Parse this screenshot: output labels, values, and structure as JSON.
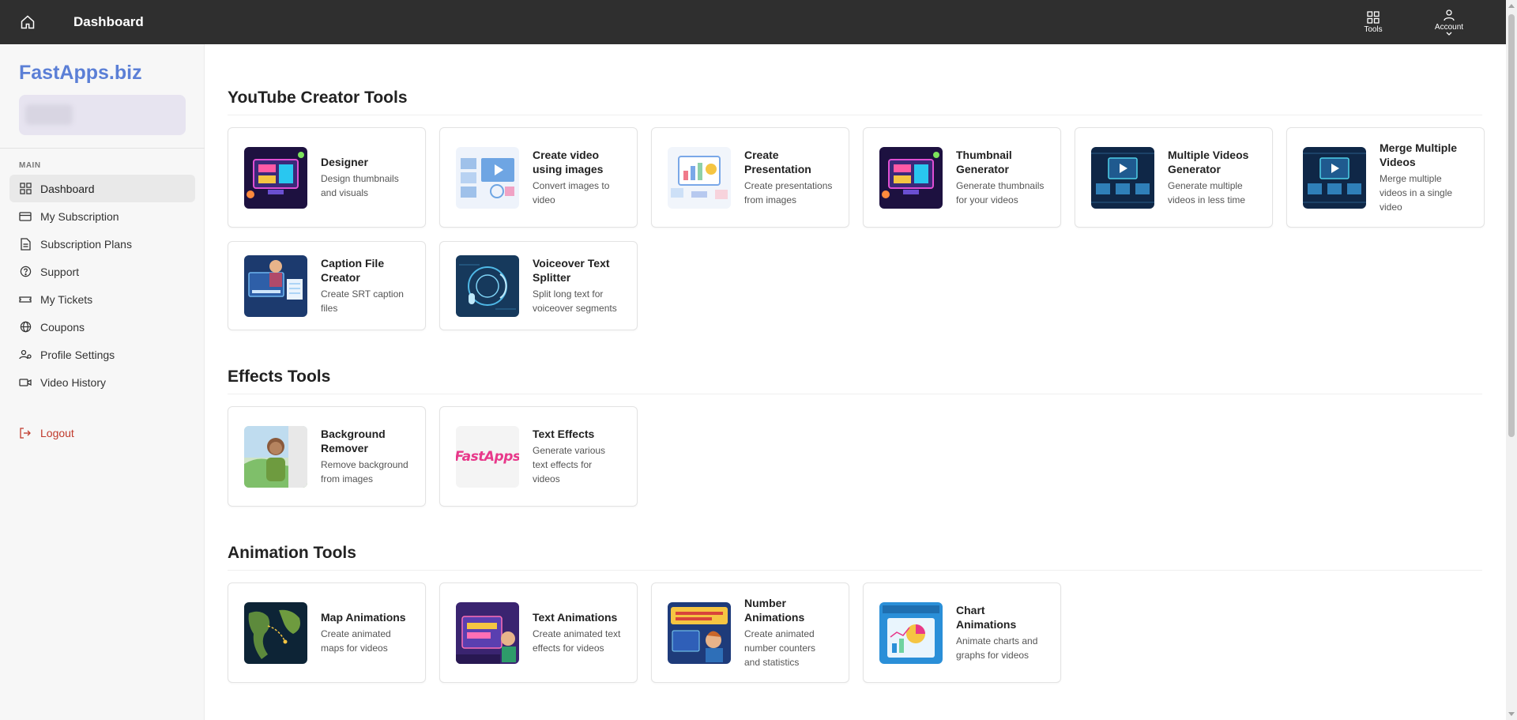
{
  "topbar": {
    "title": "Dashboard",
    "tools_label": "Tools",
    "account_label": "Account"
  },
  "sidebar": {
    "brand": "FastApps.biz",
    "section_label": "MAIN",
    "items": [
      {
        "label": "Dashboard",
        "icon": "grid-icon",
        "active": true
      },
      {
        "label": "My Subscription",
        "icon": "credit-card-icon"
      },
      {
        "label": "Subscription Plans",
        "icon": "document-icon"
      },
      {
        "label": "Support",
        "icon": "help-circle-icon"
      },
      {
        "label": "My Tickets",
        "icon": "ticket-icon"
      },
      {
        "label": "Coupons",
        "icon": "globe-icon"
      },
      {
        "label": "Profile Settings",
        "icon": "user-cog-icon"
      },
      {
        "label": "Video History",
        "icon": "video-icon"
      }
    ],
    "logout_label": "Logout"
  },
  "sections": [
    {
      "title": "YouTube Creator Tools",
      "cards": [
        {
          "title": "Designer",
          "desc": "Design thumbnails and visuals"
        },
        {
          "title": "Create video using images",
          "desc": "Convert images to video"
        },
        {
          "title": "Create Presentation",
          "desc": "Create presentations from images"
        },
        {
          "title": "Thumbnail Generator",
          "desc": "Generate thumbnails for your videos"
        },
        {
          "title": "Multiple Videos Generator",
          "desc": "Generate multiple videos in less time"
        },
        {
          "title": "Merge Multiple Videos",
          "desc": "Merge multiple videos in a single video"
        },
        {
          "title": "Caption File Creator",
          "desc": "Create SRT caption files"
        },
        {
          "title": "Voiceover Text Splitter",
          "desc": "Split long text for voiceover segments"
        }
      ]
    },
    {
      "title": "Effects Tools",
      "cards": [
        {
          "title": "Background Remover",
          "desc": "Remove background from images"
        },
        {
          "title": "Text Effects",
          "desc": "Generate various text effects for videos",
          "thumb_text": "FastApps"
        }
      ]
    },
    {
      "title": "Animation Tools",
      "cards": [
        {
          "title": "Map Animations",
          "desc": "Create animated maps for videos"
        },
        {
          "title": "Text Animations",
          "desc": "Create animated text effects for videos"
        },
        {
          "title": "Number Animations",
          "desc": "Create animated number counters and statistics"
        },
        {
          "title": "Chart Animations",
          "desc": "Animate charts and graphs for videos"
        }
      ]
    }
  ]
}
